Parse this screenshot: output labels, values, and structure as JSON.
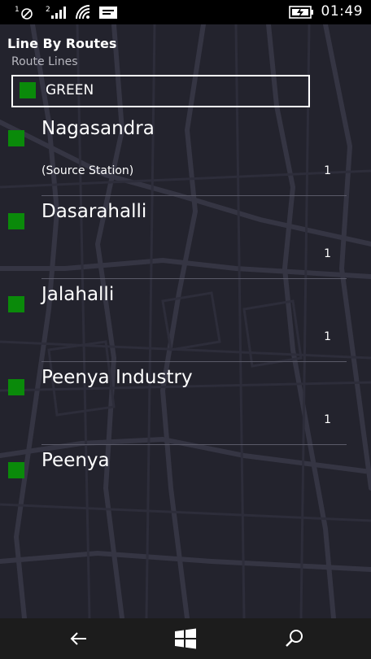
{
  "status_bar": {
    "sim1_label": "1",
    "sim2_label": "2",
    "time": "01:49",
    "icons": [
      "sim1-no-signal-icon",
      "sim2-signal-icon",
      "wifi-icon",
      "message-icon",
      "battery-charging-icon"
    ]
  },
  "header": {
    "title": "Line By Routes",
    "section_label": "Route Lines"
  },
  "route_select": {
    "value": "GREEN",
    "color": "#0a8a0a"
  },
  "stations": [
    {
      "name": "Nagasandra",
      "note": "(Source Station)",
      "count": "1"
    },
    {
      "name": "Dasarahalli",
      "note": "",
      "count": "1"
    },
    {
      "name": "Jalahalli",
      "note": "",
      "count": "1"
    },
    {
      "name": "Peenya Industry",
      "note": "",
      "count": "1"
    },
    {
      "name": "Peenya",
      "note": "",
      "count": ""
    }
  ],
  "nav_bar": {
    "icons": [
      "back-arrow-icon",
      "windows-start-icon",
      "search-icon"
    ]
  },
  "colors": {
    "line_green": "#0a8a0a",
    "background": "#23232d",
    "map_roads": "#3a3a48"
  }
}
